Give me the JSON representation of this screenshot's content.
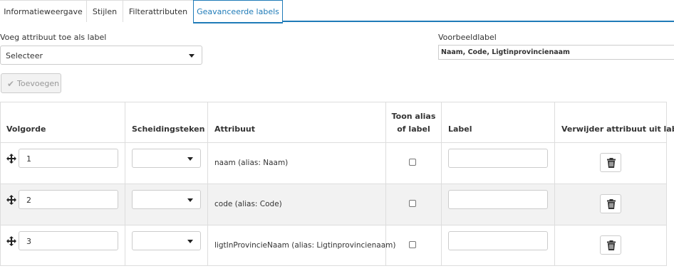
{
  "tabs": [
    {
      "label": "Informatieweergave"
    },
    {
      "label": "Stijlen"
    },
    {
      "label": "Filterattributen"
    },
    {
      "label": "Geavanceerde labels"
    }
  ],
  "add_attribute": {
    "label": "Voeg attribuut toe als label",
    "select_value": "Selecteer",
    "button_label": "Toevoegen"
  },
  "preview": {
    "label": "Voorbeeldlabel",
    "value": "Naam, Code, Ligtinprovincienaam"
  },
  "table": {
    "headers": {
      "order": "Volgorde",
      "separator": "Scheidingsteken",
      "attribute": "Attribuut",
      "show_alias_line1": "Toon alias",
      "show_alias_line2": "of label",
      "label": "Label",
      "remove": "Verwijder attribuut uit label"
    },
    "rows": [
      {
        "order": "1",
        "separator": "",
        "attribute": "naam (alias: Naam)",
        "show_alias": false,
        "label": ""
      },
      {
        "order": "2",
        "separator": "",
        "attribute": "code (alias: Code)",
        "show_alias": false,
        "label": ""
      },
      {
        "order": "3",
        "separator": "",
        "attribute": "ligtInProvincieNaam (alias: Ligtinprovincienaam)",
        "show_alias": false,
        "label": ""
      }
    ]
  },
  "colors": {
    "accent": "#1f7bb8",
    "border": "#dddddd",
    "row_stripe": "#f2f2f2"
  },
  "icons": {
    "add_button": "check-icon",
    "drag_handle": "move-arrows-icon",
    "delete": "trash-icon",
    "select": "caret-down-icon"
  }
}
